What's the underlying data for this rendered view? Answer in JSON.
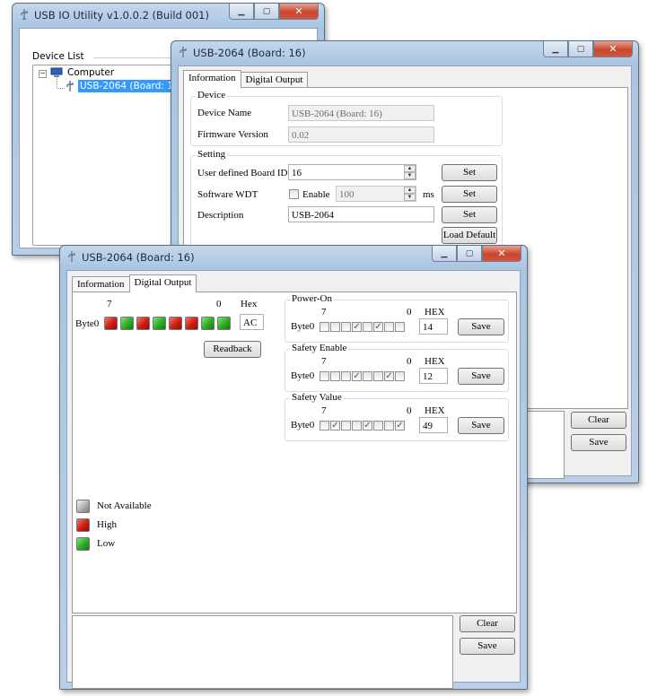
{
  "main_window": {
    "title": "USB IO Utility   v1.0.0.2 (Build 001)",
    "device_list_label": "Device List",
    "tree": {
      "root": "Computer",
      "child": "USB-2064 (Board: 16)"
    }
  },
  "info_window": {
    "title": "USB-2064 (Board: 16)",
    "tabs": [
      "Information",
      "Digital Output"
    ],
    "device_group": "Device",
    "device_name_label": "Device Name",
    "device_name_value": "USB-2064 (Board: 16)",
    "firmware_label": "Firmware Version",
    "firmware_value": "0.02",
    "setting_group": "Setting",
    "board_id_label": "User defined Board ID",
    "board_id_value": "16",
    "wdt_label": "Software WDT",
    "wdt_enable_label": "Enable",
    "wdt_value": "100",
    "wdt_unit": "ms",
    "description_label": "Description",
    "description_value": "USB-2064",
    "set_label": "Set",
    "load_default_label": "Load Default",
    "clear_label": "Clear",
    "save_label": "Save"
  },
  "do_window": {
    "title": "USB-2064 (Board: 16)",
    "tabs": [
      "Information",
      "Digital Output"
    ],
    "bit_high": "7",
    "bit_low": "0",
    "hex_label": "Hex",
    "byte_label": "Byte0",
    "leds": [
      "high",
      "low",
      "high",
      "low",
      "high",
      "high",
      "low",
      "low"
    ],
    "hex_value": "AC",
    "readback_label": "Readback",
    "groups": [
      {
        "title": "Power-On",
        "hex_header": "HEX",
        "checks": [
          false,
          false,
          false,
          true,
          false,
          true,
          false,
          false
        ],
        "hex": "14",
        "save": "Save"
      },
      {
        "title": "Safety Enable",
        "hex_header": "HEX",
        "checks": [
          false,
          false,
          false,
          true,
          false,
          false,
          true,
          false
        ],
        "hex": "12",
        "save": "Save"
      },
      {
        "title": "Safety Value",
        "hex_header": "HEX",
        "checks": [
          false,
          true,
          false,
          false,
          true,
          false,
          false,
          true
        ],
        "hex": "49",
        "save": "Save"
      }
    ],
    "legend": [
      {
        "state": "na",
        "label": "Not Available"
      },
      {
        "state": "high",
        "label": "High"
      },
      {
        "state": "low",
        "label": "Low"
      }
    ],
    "clear_label": "Clear",
    "save_label": "Save"
  },
  "colors": {
    "titlebar": "#b9cfe7",
    "selection": "#3399ff",
    "close": "#c9462d",
    "led_high": "#d41f16",
    "led_low": "#2fb324"
  }
}
